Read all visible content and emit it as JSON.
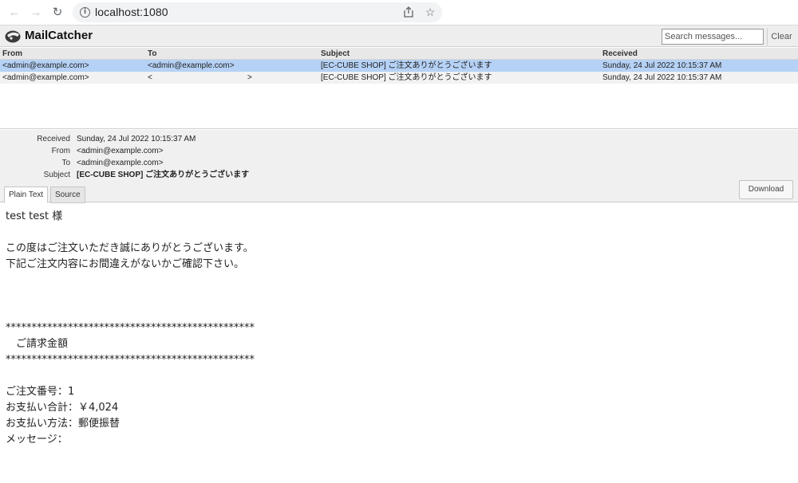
{
  "browser": {
    "url": "localhost:1080",
    "back_icon": "arrow-left-icon",
    "forward_icon": "arrow-right-icon",
    "reload_icon": "reload-icon",
    "share_icon": "share-icon",
    "bookmark_icon": "star-icon"
  },
  "app": {
    "name": "MailCatcher",
    "search_placeholder": "Search messages...",
    "clear_label": "Clear"
  },
  "list": {
    "columns": [
      "From",
      "To",
      "Subject",
      "Received"
    ],
    "rows": [
      {
        "from": "<admin@example.com>",
        "to": "<admin@example.com>",
        "subject": "[EC-CUBE SHOP] ご注文ありがとうございます",
        "received": "Sunday, 24 Jul 2022 10:15:37 AM",
        "selected": true
      },
      {
        "from": "<admin@example.com>",
        "to_start": "<",
        "to_end": ">",
        "subject": "[EC-CUBE SHOP] ご注文ありがとうございます",
        "received": "Sunday, 24 Jul 2022 10:15:37 AM",
        "selected": false
      }
    ]
  },
  "detail": {
    "received_label": "Received",
    "received": "Sunday, 24 Jul 2022 10:15:37 AM",
    "from_label": "From",
    "from": "<admin@example.com>",
    "to_label": "To",
    "to": "<admin@example.com>",
    "subject_label": "Subject",
    "subject": "[EC-CUBE SHOP] ご注文ありがとうございます",
    "tabs": [
      "Plain Text",
      "Source"
    ],
    "download_label": "Download"
  },
  "body": {
    "text": "test test 様\n\nこの度はご注文いただき誠にありがとうございます。\n下記ご注文内容にお間違えがないかご確認下さい。\n\n\n\n************************************************\n　ご請求金額\n************************************************\n\nご注文番号：1\nお支払い合計：￥4,024\nお支払い方法：郵便振替\nメッセージ："
  },
  "colors": {
    "selected_row": "#b5d1f5",
    "header_bg": "#eeeeee"
  }
}
